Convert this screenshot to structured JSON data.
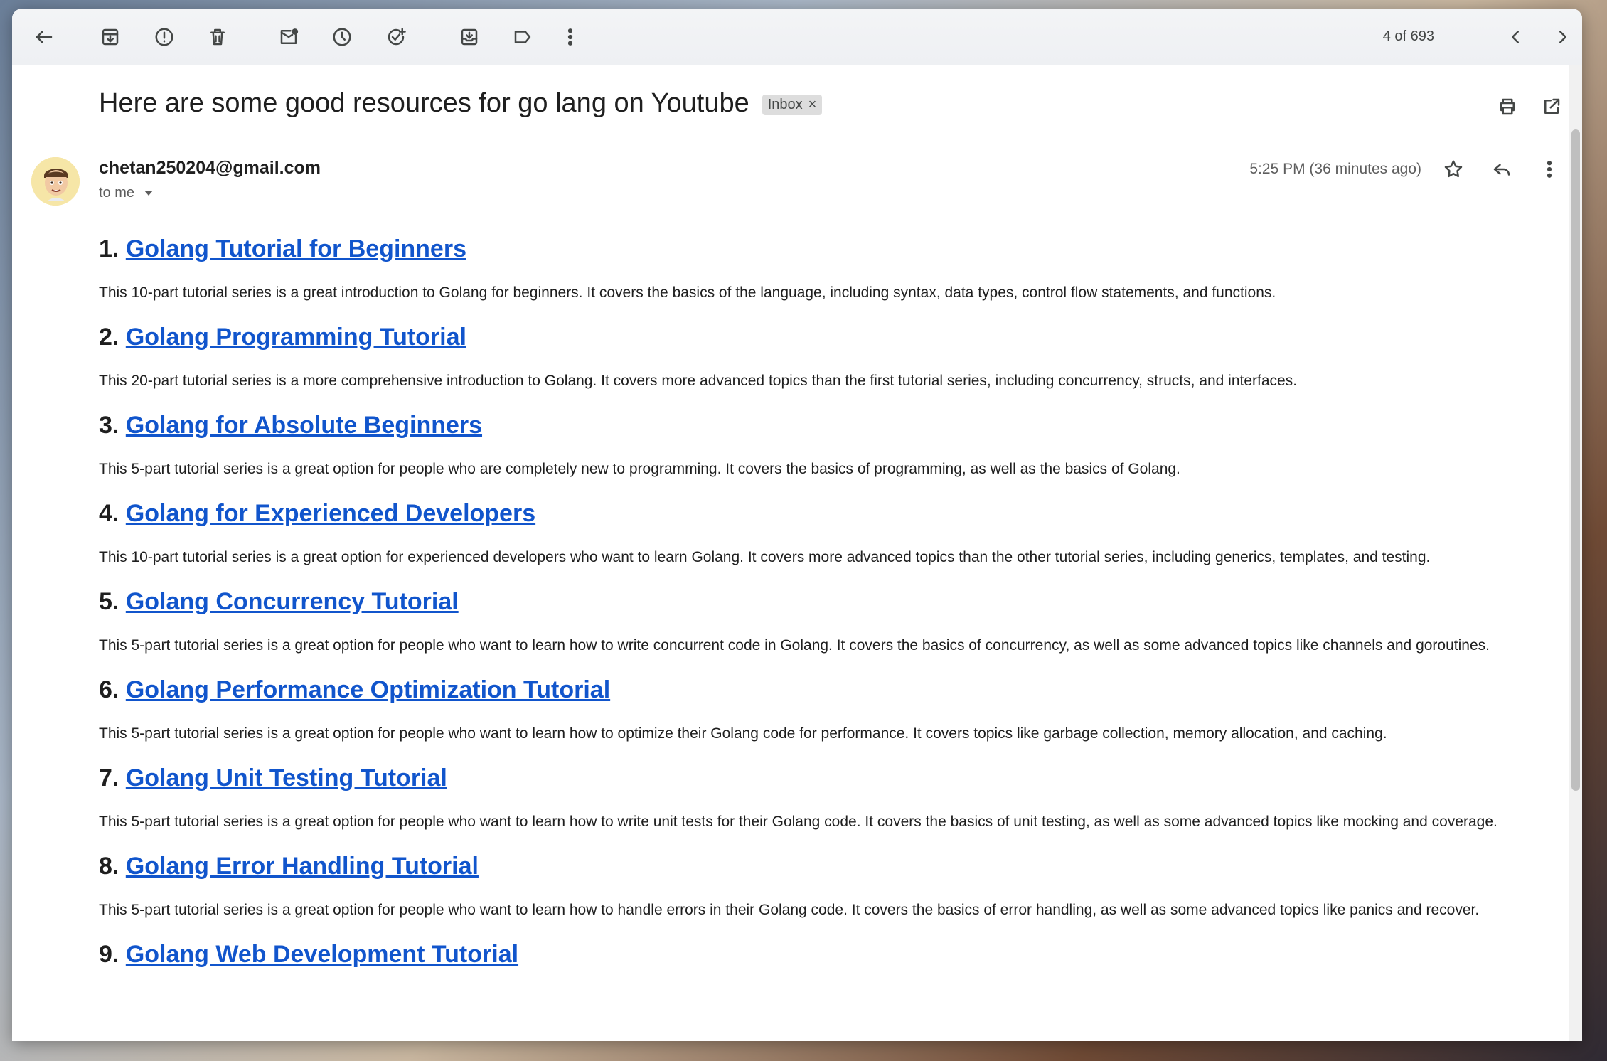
{
  "toolbar": {
    "pager_text": "4 of 693"
  },
  "message": {
    "subject": "Here are some good resources for go lang on Youtube",
    "label": "Inbox",
    "label_remove": "×",
    "sender": "chetan250204@gmail.com",
    "recipient": "to me",
    "timestamp": "5:25 PM (36 minutes ago)"
  },
  "items": [
    {
      "num": "1.",
      "title": "Golang Tutorial for Beginners",
      "desc": "This 10-part tutorial series is a great introduction to Golang for beginners. It covers the basics of the language, including syntax, data types, control flow statements, and functions."
    },
    {
      "num": "2.",
      "title": "Golang Programming Tutorial",
      "desc": "This 20-part tutorial series is a more comprehensive introduction to Golang. It covers more advanced topics than the first tutorial series, including concurrency, structs, and interfaces."
    },
    {
      "num": "3.",
      "title": "Golang for Absolute Beginners",
      "desc": "This 5-part tutorial series is a great option for people who are completely new to programming. It covers the basics of programming, as well as the basics of Golang."
    },
    {
      "num": "4.",
      "title": "Golang for Experienced Developers",
      "desc": "This 10-part tutorial series is a great option for experienced developers who want to learn Golang. It covers more advanced topics than the other tutorial series, including generics, templates, and testing."
    },
    {
      "num": "5.",
      "title": "Golang Concurrency Tutorial",
      "desc": "This 5-part tutorial series is a great option for people who want to learn how to write concurrent code in Golang. It covers the basics of concurrency, as well as some advanced topics like channels and goroutines."
    },
    {
      "num": "6.",
      "title": "Golang Performance Optimization Tutorial",
      "desc": "This 5-part tutorial series is a great option for people who want to learn how to optimize their Golang code for performance. It covers topics like garbage collection, memory allocation, and caching."
    },
    {
      "num": "7.",
      "title": "Golang Unit Testing Tutorial",
      "desc": "This 5-part tutorial series is a great option for people who want to learn how to write unit tests for their Golang code. It covers the basics of unit testing, as well as some advanced topics like mocking and coverage."
    },
    {
      "num": "8.",
      "title": "Golang Error Handling Tutorial",
      "desc": "This 5-part tutorial series is a great option for people who want to learn how to handle errors in their Golang code. It covers the basics of error handling, as well as some advanced topics like panics and recover."
    },
    {
      "num": "9.",
      "title": "Golang Web Development Tutorial",
      "desc": ""
    }
  ],
  "colors": {
    "link": "#1155cc",
    "text": "#1f1f1f",
    "chip_bg": "#dddddd",
    "toolbar_bg": "#eef0f3"
  }
}
